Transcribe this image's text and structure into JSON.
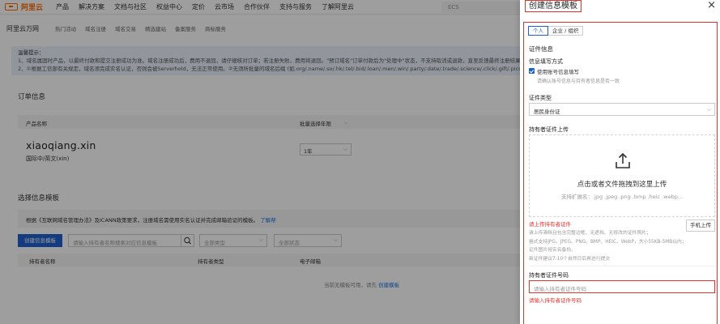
{
  "topnav": {
    "logo_text": "阿里云",
    "items": [
      "产品",
      "解决方案",
      "文档与社区",
      "权益中心",
      "定价",
      "云市场",
      "合作伙伴",
      "支持与服务",
      "了解阿里云"
    ],
    "search_value": "ECS"
  },
  "subnav": {
    "brand": "阿里云万网",
    "items": [
      "热门活动",
      "域名注册",
      "域名交易",
      "精选建站",
      "备案服务",
      "商标服务"
    ]
  },
  "notice": {
    "title": "温馨提示：",
    "line1": "1、域名属固时产品，以最终付款和提交注册成功为准。域名注册成功后，费用不退回，请仔细核对订单；若注册失败，费用将退回。\"预订域名\"订单付款后为\"处理中\"状态，不支持取消或退款，直至反馈最终注册结果。了",
    "line2": "2、①根据工信部有关规定，域名须完成实名认证，否则会被Serverhold，无法正常使用。②无须所批量的域名后缀 (如.org/.name/.so/.hk/.tel/.bid/.loan/.men/.win/.party/.date/.trade/.science/.click/.gift/.pics/.pho"
  },
  "order": {
    "section_title": "订单信息",
    "col_product": "产品名称",
    "col_years": "批量选择年限",
    "product_name": "xiaoqiang.xin",
    "product_sub": "国际中/英文(xin)",
    "years_value": "1年"
  },
  "templates": {
    "section_title": "选择信息模板",
    "tip_text": "根据《互联网域名管理办法》及ICANN政策要求，注册域名需使用实名认证并完成邮箱验证的模板。",
    "tip_link": "了解帮",
    "create_button": "创建信息模板",
    "search_placeholder": "请输入持有者名称搜索对应信息模板",
    "filter_type": "全部类型",
    "filter_status": "全部状态",
    "col_holder": "持有者名称",
    "col_holder_type": "持有者类型",
    "col_email": "电子邮箱",
    "empty_text": "当前无模板可用，请先",
    "empty_link": "创建模板"
  },
  "drawer": {
    "title": "创建信息模板",
    "close_icon": "×",
    "tab_personal": "个人",
    "tab_org": "企业 / 组织",
    "cert_info_label": "证件信息",
    "fill_method_label": "信息填写方式",
    "use_account_label": "使用账号信息填写",
    "use_account_hint": "请确认账号信息与持有者信息是否一致",
    "cert_type_label": "证件类型",
    "cert_type_value": "居民身份证",
    "holder_cert_upload_label": "持有者证件上传",
    "upload_main": "点击或者文件拖拽到这里上传",
    "upload_hint": "支持扩展名：.jpg .jpeg .png .bmp .heic .webp...",
    "upload_error": "请上传持有者证件",
    "phone_upload_button": "手机上传",
    "rules": [
      "请上传清晰且包含完整边框、无遮挡、无修改的证件照片；",
      "格式支持JPG、JPEG、PNG、BMP、HEIC、WebP，大小55KB-5MB以内；",
      "证件图片将实名备份。",
      "新证件建议7-10个自然日后再进行提交"
    ],
    "holder_cert_no_label": "持有者证件号码",
    "cert_no_placeholder": "请输入持有者证件号码",
    "cert_no_error": "请输入持有者证件号码"
  }
}
